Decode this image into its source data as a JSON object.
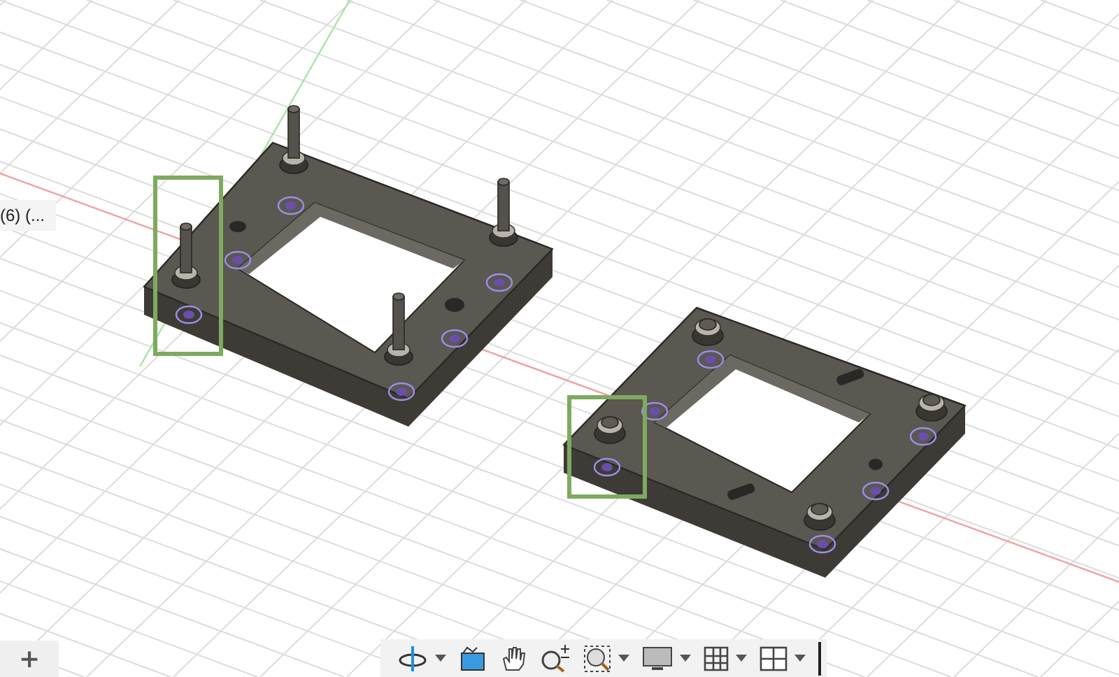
{
  "browser_label": "(6) (...",
  "add_button": "+",
  "toolbar": [
    {
      "kind": "orbit",
      "dropdown": true
    },
    {
      "kind": "look-at",
      "dropdown": false
    },
    {
      "kind": "pan",
      "dropdown": false
    },
    {
      "kind": "zoom",
      "dropdown": false
    },
    {
      "kind": "fit",
      "dropdown": true
    },
    {
      "kind": "display",
      "dropdown": true
    },
    {
      "kind": "grid",
      "dropdown": true
    },
    {
      "kind": "viewports",
      "dropdown": true
    }
  ]
}
